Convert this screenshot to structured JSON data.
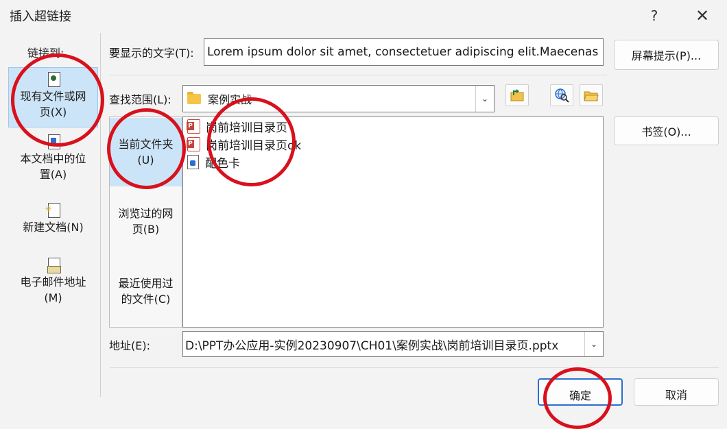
{
  "dialog": {
    "title": "插入超链接",
    "help": "?",
    "close": "✕"
  },
  "link_to": {
    "heading": "链接到:",
    "items": [
      {
        "label_1": "现有文件或网",
        "label_2": "页(X)"
      },
      {
        "label_1": "本文档中的位",
        "label_2": "置(A)"
      },
      {
        "label_1": "新建文档(N)"
      },
      {
        "label_1": "电子邮件地址",
        "label_2": "(M)"
      }
    ]
  },
  "display_text": {
    "label": "要显示的文字(T):",
    "value": "Lorem ipsum dolor sit amet, consectetuer adipiscing elit.Maecenas"
  },
  "screen_tip_button": "屏幕提示(P)...",
  "look_in": {
    "label": "查找范围(L):",
    "value": "案例实战"
  },
  "bookmark_button": "书签(O)...",
  "look_in_tabs": [
    {
      "label_1": "当前文件夹",
      "label_2": "(U)"
    },
    {
      "label_1": "浏览过的网",
      "label_2": "页(B)"
    },
    {
      "label_1": "最近使用过",
      "label_2": "的文件(C)"
    }
  ],
  "files": [
    {
      "name": "岗前培训目录页",
      "icon": "powerpoint-file-icon"
    },
    {
      "name": "岗前培训目录页ok",
      "icon": "powerpoint-file-icon"
    },
    {
      "name": "配色卡",
      "icon": "image-file-icon"
    }
  ],
  "address": {
    "label": "地址(E):",
    "value": "D:\\PPT办公应用-实例20230907\\CH01\\案例实战\\岗前培训目录页.pptx"
  },
  "ok_button": "确定",
  "cancel_button": "取消",
  "colors": {
    "selection": "#cce4f7",
    "annotation_red": "#d8111c",
    "background": "#f3f3f3"
  }
}
